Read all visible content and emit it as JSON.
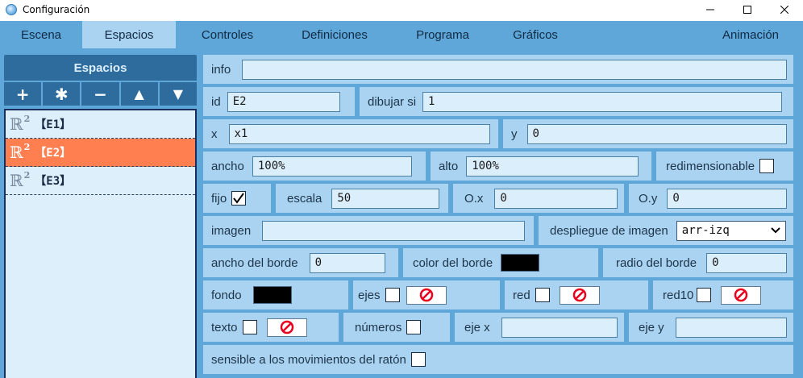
{
  "window": {
    "title": "Configuración",
    "minimize_glyph": "—",
    "maximize_glyph": "☐",
    "close_glyph": "✕"
  },
  "tabs": [
    {
      "label": "Escena",
      "active": false
    },
    {
      "label": "Espacios",
      "active": true
    },
    {
      "label": "Controles",
      "active": false
    },
    {
      "label": "Definiciones",
      "active": false
    },
    {
      "label": "Programa",
      "active": false
    },
    {
      "label": "Gráficos",
      "active": false
    },
    {
      "label": "Animación",
      "active": false
    }
  ],
  "left_panel": {
    "header": "Espacios",
    "toolbar": {
      "add": "+",
      "copy": "✱",
      "remove": "−",
      "up": "▲",
      "down": "▼"
    },
    "spaces": [
      {
        "symbol": "ℝ",
        "sup": "2",
        "label": "【E1】",
        "selected": false
      },
      {
        "symbol": "ℝ",
        "sup": "2",
        "label": "【E2】",
        "selected": true
      },
      {
        "symbol": "ℝ",
        "sup": "2",
        "label": "【E3】",
        "selected": false
      }
    ]
  },
  "form": {
    "info": {
      "label": "info",
      "value": ""
    },
    "id": {
      "label": "id",
      "value": "E2"
    },
    "dibujar_si": {
      "label": "dibujar si",
      "value": "1"
    },
    "x": {
      "label": "x",
      "value": "x1"
    },
    "y": {
      "label": "y",
      "value": "0"
    },
    "ancho": {
      "label": "ancho",
      "value": "100%"
    },
    "alto": {
      "label": "alto",
      "value": "100%"
    },
    "redimensionable": {
      "label": "redimensionable",
      "checked": false
    },
    "fijo": {
      "label": "fijo",
      "checked": true
    },
    "escala": {
      "label": "escala",
      "value": "50"
    },
    "ox": {
      "label": "O.x",
      "value": "0"
    },
    "oy": {
      "label": "O.y",
      "value": "0"
    },
    "imagen": {
      "label": "imagen",
      "value": ""
    },
    "despliegue": {
      "label": "despliegue de imagen",
      "value": "arr-izq"
    },
    "ancho_borde": {
      "label": "ancho del borde",
      "value": "0"
    },
    "color_borde": {
      "label": "color del borde",
      "color": "#000000"
    },
    "radio_borde": {
      "label": "radio del borde",
      "value": "0"
    },
    "fondo": {
      "label": "fondo",
      "color": "#000000"
    },
    "ejes": {
      "label": "ejes",
      "checked": false
    },
    "red": {
      "label": "red",
      "checked": false
    },
    "red10": {
      "label": "red10",
      "checked": false
    },
    "texto": {
      "label": "texto",
      "checked": false
    },
    "numeros": {
      "label": "números",
      "checked": false
    },
    "eje_x": {
      "label": "eje x",
      "value": ""
    },
    "eje_y": {
      "label": "eje y",
      "value": ""
    },
    "sensible": {
      "label": "sensible a los movimientos del ratón",
      "checked": false
    }
  },
  "colors": {
    "background": "#5fa7d9",
    "cell": "#a9d3f1",
    "input": "#dbeefb",
    "dark_button": "#2e6c9e",
    "selected_item": "#ff7f50",
    "no_icon": "#e8001c"
  },
  "icons": {
    "app": "app-globe-icon",
    "no_color": "no-sign-icon",
    "check": "check-icon",
    "select": "chevron-down-icon"
  }
}
